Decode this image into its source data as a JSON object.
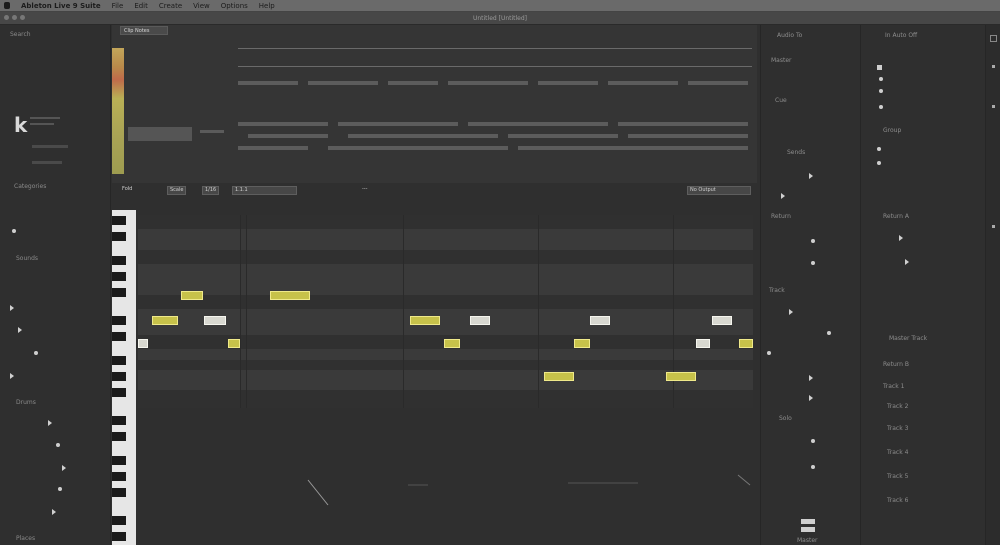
{
  "menubar": {
    "apple": "",
    "app": "Ableton Live 9 Suite",
    "items": [
      "File",
      "Edit",
      "Create",
      "View",
      "Options",
      "Help"
    ]
  },
  "titlebar": {
    "title": "Untitled  [Untitled]"
  },
  "browser": {
    "search_label": "Search",
    "logo_letter": "k",
    "section_labels": [
      "Categories",
      "Sounds",
      "Drums",
      "Places"
    ],
    "colors": {
      "panel": "#2f2f2f",
      "text": "#8a8a8a"
    }
  },
  "clip": {
    "tab_label": "Clip Notes",
    "colors": {
      "note": "#c7c24a",
      "note_selected": "#d8d8d0",
      "grid": "#3a3a3a",
      "lane": "#303030"
    }
  },
  "note_toolbar": {
    "fold": "Fold",
    "scale": "Scale",
    "value1": "1/16",
    "value2": "---",
    "value3": "1.1.1",
    "dropdown": "No Output"
  },
  "right_panel": {
    "header": "Audio To",
    "labels": [
      "Master",
      "Cue",
      "Sends",
      "Return",
      "Track",
      "Solo"
    ],
    "footer": "Master"
  },
  "right_panel2": {
    "header": "In Auto Off",
    "labels": [
      "Group",
      "Return A",
      "Return B",
      "Track 1",
      "Track 2",
      "Track 3",
      "Track 4",
      "Track 5",
      "Track 6"
    ],
    "active_label": "Master Track"
  }
}
